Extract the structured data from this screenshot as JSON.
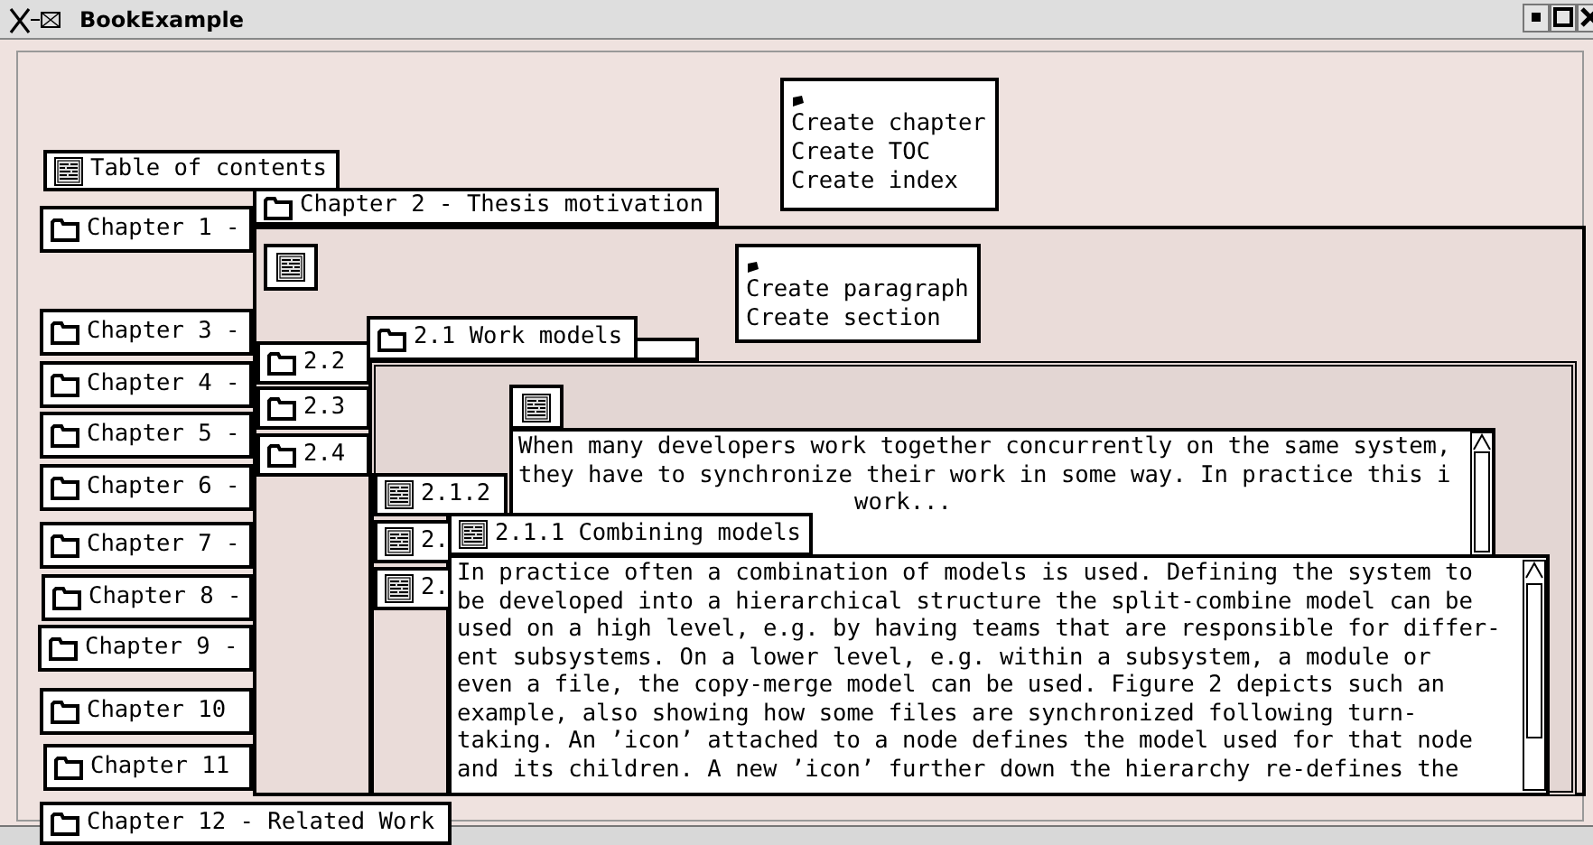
{
  "window": {
    "title": "BookExample"
  },
  "book_menu": {
    "items": [
      "Create chapter",
      "Create TOC",
      "Create index"
    ]
  },
  "toc_items": [
    {
      "kind": "document",
      "label": "Table of contents"
    },
    {
      "kind": "folder",
      "label": "Chapter 1 -"
    },
    {
      "kind": "folder",
      "label": "Chapter 3 -"
    },
    {
      "kind": "folder",
      "label": "Chapter 4 -"
    },
    {
      "kind": "folder",
      "label": "Chapter 5 -"
    },
    {
      "kind": "folder",
      "label": "Chapter 6 -"
    },
    {
      "kind": "folder",
      "label": "Chapter 7 -"
    },
    {
      "kind": "folder",
      "label": "Chapter 8 -"
    },
    {
      "kind": "folder",
      "label": "Chapter 9 -"
    },
    {
      "kind": "folder",
      "label": "Chapter 10"
    },
    {
      "kind": "folder",
      "label": "Chapter 11"
    },
    {
      "kind": "folder",
      "label": "Chapter 12 - Related Work"
    }
  ],
  "chapter": {
    "tab": "Chapter 2 - Thesis motivation",
    "menu": {
      "items": [
        "Create paragraph",
        "Create section"
      ]
    },
    "section_tabs": [
      "2.2",
      "2.3",
      "2.4"
    ],
    "section": {
      "tab": "2.1 Work models",
      "paragraph": "When many developers work together concurrently on the same system,\nthey have to synchronize their work in some way. In practice this i",
      "paragraph_tail": "work...",
      "subsection_tabs": [
        "2.1.2",
        "2.",
        "2."
      ],
      "subsection": {
        "tab": "2.1.1 Combining models",
        "paragraph": "In practice often a combination of models is used. Defining the system to\nbe developed into a hierarchical structure the split-combine model can be\nused on a high level, e.g. by having teams that are responsible for differ-\nent subsystems. On a lower level, e.g. within a subsystem, a module or\neven a file, the copy-merge model can be used. Figure 2 depicts such an\nexample, also showing how some files are synchronized following turn-\ntaking. An ’icon’ attached to a node defines the model used for that node\nand its children. A new ’icon’ further down the hierarchy re-defines the"
      }
    }
  }
}
